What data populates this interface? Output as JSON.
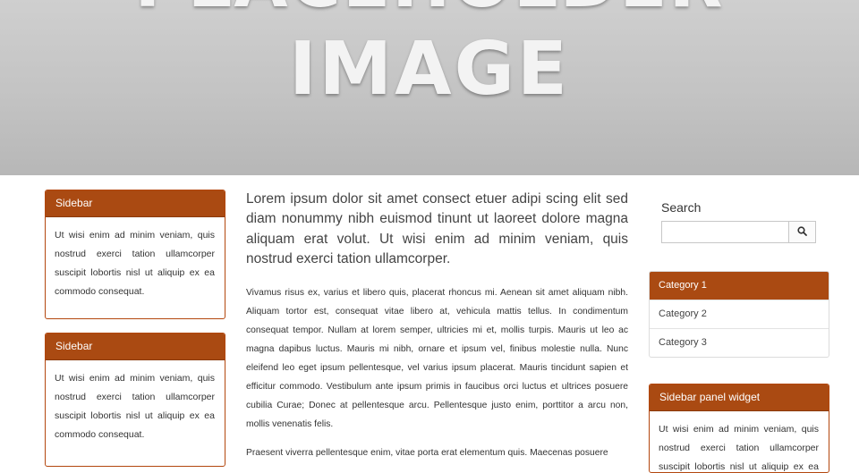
{
  "hero": {
    "line1": "PLACEHOLDER",
    "line2": "IMAGE"
  },
  "left_sidebar": [
    {
      "title": "Sidebar",
      "text": "Ut wisi enim ad minim veniam, quis nostrud exerci tation ullamcorper suscipit lobortis nisl ut aliquip ex ea commodo consequat."
    },
    {
      "title": "Sidebar",
      "text": "Ut wisi enim ad minim veniam, quis nostrud exerci tation ullamcorper suscipit lobortis nisl ut aliquip ex ea commodo consequat."
    }
  ],
  "main": {
    "lead": "Lorem ipsum dolor sit amet consect etuer adipi scing elit sed diam nonummy nibh euismod tinunt ut laoreet dolore magna aliquam erat volut. Ut wisi enim ad minim veniam, quis nostrud exerci tation ullamcorper.",
    "paragraph1": "Vivamus risus ex, varius et libero quis, placerat rhoncus mi. Aenean sit amet aliquam nibh. Aliquam tortor est, consequat vitae libero at, vehicula mattis tellus. In condimentum consequat tempor. Nullam at lorem semper, ultricies mi et, mollis turpis. Mauris ut leo ac magna dapibus luctus. Mauris mi nibh, ornare et ipsum vel, finibus molestie nulla. Nunc eleifend leo eget ipsum pellentesque, vel varius ipsum placerat. Mauris tincidunt sapien et efficitur commodo. Vestibulum ante ipsum primis in faucibus orci luctus et ultrices posuere cubilia Curae; Donec at pellentesque arcu. Pellentesque justo enim, porttitor a arcu non, mollis venenatis felis.",
    "paragraph2": "Praesent viverra pellentesque enim, vitae porta erat elementum quis. Maecenas posuere"
  },
  "right_sidebar": {
    "search_label": "Search",
    "search_value": "",
    "categories": [
      "Category 1",
      "Category 2",
      "Category 3"
    ],
    "widget": {
      "title": "Sidebar panel widget",
      "text": "Ut wisi enim ad minim veniam, quis nostrud exerci tation ullamcorper suscipit lobortis nisl ut aliquip ex ea commodo consequat."
    }
  },
  "colors": {
    "accent": "#aa4a12",
    "hero_bg": "#c4c4c4"
  },
  "icons": {
    "search_button": "search-icon"
  }
}
